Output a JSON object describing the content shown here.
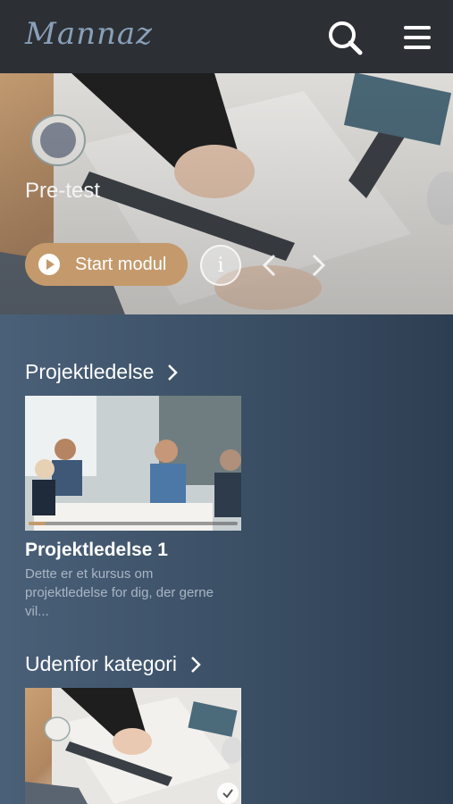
{
  "header": {
    "logo_text": "Mannaz",
    "search_icon": "search-icon",
    "menu_icon": "hamburger-menu-icon"
  },
  "hero": {
    "title": "Pre-test",
    "start_label": "Start modul",
    "info_label": "i",
    "accent_color": "#c49a6c"
  },
  "sections": [
    {
      "title": "Projektledelse",
      "card": {
        "title": "Projektledelse 1",
        "description": "Dette er et kursus om projektledelse for dig, der gerne vil...",
        "progress": 0.08
      }
    },
    {
      "title": "Udenfor kategori",
      "card": {
        "completed": true
      }
    }
  ]
}
